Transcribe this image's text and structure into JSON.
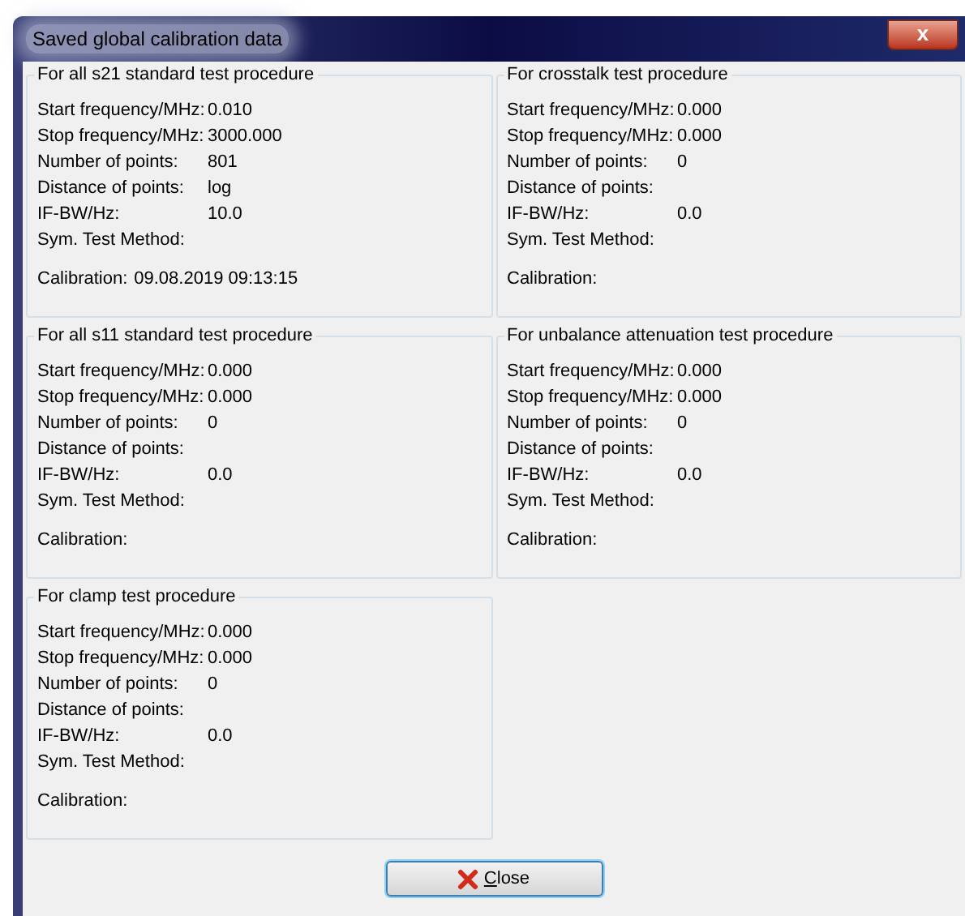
{
  "window": {
    "title": "Saved global calibration data",
    "close_glyph": "x"
  },
  "groups": [
    {
      "title": "For all s21 standard test procedure",
      "fields": [
        {
          "label": "Start frequency/MHz:",
          "value": "0.010"
        },
        {
          "label": "Stop frequency/MHz:",
          "value": "3000.000"
        },
        {
          "label": "Number of points:",
          "value": "801"
        },
        {
          "label": "Distance of points:",
          "value": "log"
        },
        {
          "label": "IF-BW/Hz:",
          "value": "10.0"
        },
        {
          "label": "Sym. Test Method:"
        }
      ],
      "calibration": {
        "label": "Calibration:",
        "value": "09.08.2019 09:13:15"
      }
    },
    {
      "title": "For crosstalk test procedure",
      "fields": [
        {
          "label": "Start frequency/MHz:",
          "value": "0.000"
        },
        {
          "label": "Stop frequency/MHz:",
          "value": "0.000"
        },
        {
          "label": "Number of points:",
          "value": "0"
        },
        {
          "label": "Distance of points:"
        },
        {
          "label": "IF-BW/Hz:",
          "value": "0.0"
        },
        {
          "label": "Sym. Test Method:"
        }
      ],
      "calibration": {
        "label": "Calibration:"
      }
    },
    {
      "title": "For all s11 standard test procedure",
      "fields": [
        {
          "label": "Start frequency/MHz:",
          "value": "0.000"
        },
        {
          "label": "Stop frequency/MHz:",
          "value": "0.000"
        },
        {
          "label": "Number of points:",
          "value": "0"
        },
        {
          "label": "Distance of points:"
        },
        {
          "label": "IF-BW/Hz:",
          "value": "0.0"
        },
        {
          "label": "Sym. Test Method:"
        }
      ],
      "calibration": {
        "label": "Calibration:"
      }
    },
    {
      "title": "For unbalance attenuation test procedure",
      "fields": [
        {
          "label": "Start frequency/MHz:",
          "value": "0.000"
        },
        {
          "label": "Stop frequency/MHz:",
          "value": "0.000"
        },
        {
          "label": "Number of points:",
          "value": "0"
        },
        {
          "label": "Distance of points:"
        },
        {
          "label": "IF-BW/Hz:",
          "value": "0.0"
        },
        {
          "label": "Sym. Test Method:"
        }
      ],
      "calibration": {
        "label": "Calibration:"
      }
    },
    {
      "title": "For clamp test procedure",
      "fields": [
        {
          "label": "Start frequency/MHz:",
          "value": "0.000"
        },
        {
          "label": "Stop frequency/MHz:",
          "value": "0.000"
        },
        {
          "label": "Number of points:",
          "value": "0"
        },
        {
          "label": "Distance of points:"
        },
        {
          "label": "IF-BW/Hz:",
          "value": "0.0"
        },
        {
          "label": "Sym. Test Method:"
        }
      ],
      "calibration": {
        "label": "Calibration:"
      }
    }
  ],
  "buttons": [
    {
      "label": "Close"
    }
  ]
}
